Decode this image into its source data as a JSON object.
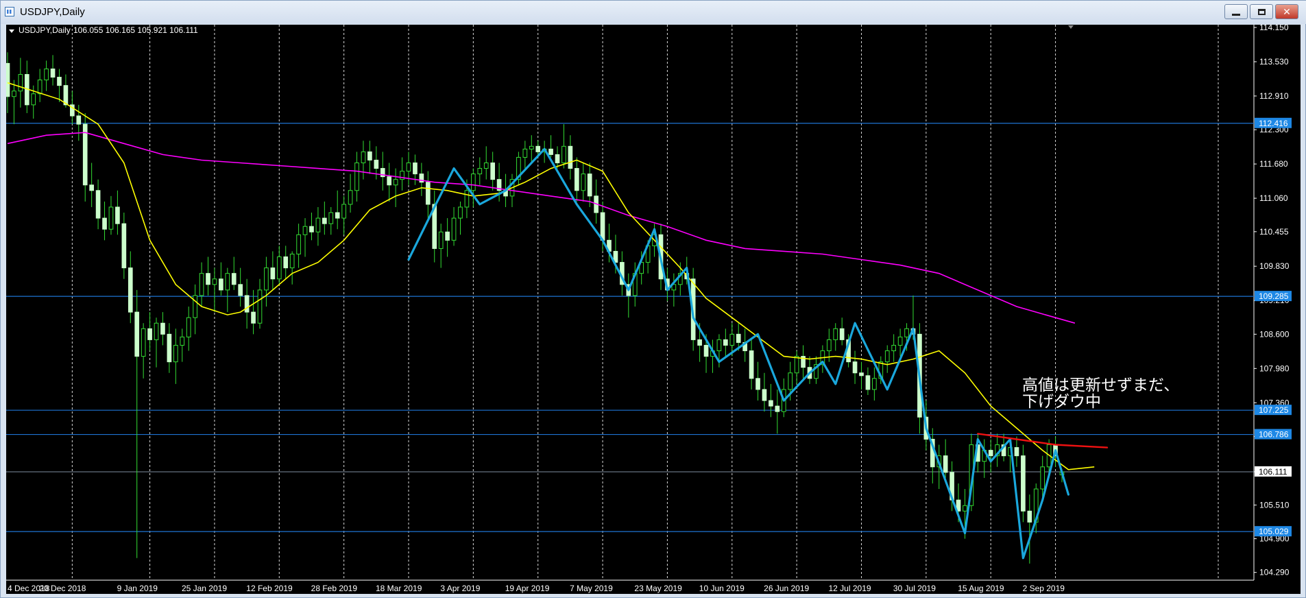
{
  "window": {
    "title": "USDJPY,Daily",
    "buttons": {
      "minimize_icon": "minimize-icon",
      "maximize_icon": "maximize-icon",
      "close_icon": "close-icon"
    }
  },
  "chart_data": {
    "type": "candlestick",
    "header": {
      "symbol_label": "USDJPY,Daily",
      "ohlc_text": "106.055 106.165 105.921 106.111"
    },
    "y_ticks": [
      "114.150",
      "113.530",
      "112.910",
      "112.300",
      "111.680",
      "111.060",
      "110.455",
      "109.830",
      "109.210",
      "108.600",
      "107.980",
      "107.360",
      "106.750",
      "106.111",
      "105.510",
      "104.900",
      "104.290"
    ],
    "x_ticks": [
      "4 Dec 2018",
      "20 Dec 2018",
      "9 Jan 2019",
      "25 Jan 2019",
      "12 Feb 2019",
      "28 Feb 2019",
      "18 Mar 2019",
      "3 Apr 2019",
      "19 Apr 2019",
      "7 May 2019",
      "23 May 2019",
      "10 Jun 2019",
      "26 Jun 2019",
      "12 Jul 2019",
      "30 Jul 2019",
      "15 Aug 2019",
      "2 Sep 2019"
    ],
    "horizontal_levels": [
      {
        "value": 112.416,
        "label": "112.416"
      },
      {
        "value": 109.285,
        "label": "109.285"
      },
      {
        "value": 107.225,
        "label": "107.225"
      },
      {
        "value": 106.786,
        "label": "106.786"
      },
      {
        "value": 105.029,
        "label": "105.029"
      }
    ],
    "current_price": {
      "value": 106.111,
      "label": "106.111"
    },
    "ylim": [
      104.15,
      114.2
    ],
    "colors": {
      "background": "#000000",
      "bull_candle": "#ccffcc",
      "bear_candle": "#ccffcc",
      "wick": "#33dd33",
      "ma_fast": "#ffff00",
      "ma_slow": "#ff00ff",
      "level_line": "#1e73d2",
      "level_label_bg": "#1e88e5",
      "zigzag": "#1aa7dc",
      "trend_line": "#ee1111",
      "grid": "#ffffff"
    },
    "annotation": {
      "line1": "高値は更新せずまだ、",
      "line2": "下げダウ中"
    },
    "candles_ohlc": [
      [
        113.5,
        113.7,
        112.6,
        112.9
      ],
      [
        112.9,
        113.2,
        112.4,
        113.0
      ],
      [
        113.0,
        113.6,
        112.7,
        113.3
      ],
      [
        113.3,
        113.55,
        112.6,
        112.75
      ],
      [
        112.75,
        113.1,
        112.5,
        112.95
      ],
      [
        112.95,
        113.4,
        112.8,
        113.2
      ],
      [
        113.2,
        113.55,
        113.0,
        113.4
      ],
      [
        113.4,
        113.65,
        113.1,
        113.25
      ],
      [
        113.25,
        113.4,
        112.8,
        113.1
      ],
      [
        113.1,
        113.3,
        112.7,
        112.75
      ],
      [
        112.75,
        113.0,
        112.4,
        112.55
      ],
      [
        112.55,
        112.75,
        112.1,
        112.4
      ],
      [
        112.4,
        112.6,
        111.0,
        111.3
      ],
      [
        111.3,
        111.7,
        110.9,
        111.2
      ],
      [
        111.2,
        111.4,
        110.5,
        110.7
      ],
      [
        110.7,
        111.0,
        110.3,
        110.5
      ],
      [
        110.5,
        111.1,
        110.4,
        110.9
      ],
      [
        110.9,
        111.2,
        110.4,
        110.6
      ],
      [
        110.6,
        110.8,
        109.6,
        109.8
      ],
      [
        109.8,
        110.1,
        108.8,
        109.0
      ],
      [
        109.0,
        109.4,
        104.55,
        108.2
      ],
      [
        108.2,
        108.8,
        107.8,
        108.7
      ],
      [
        108.7,
        109.0,
        108.3,
        108.5
      ],
      [
        108.5,
        108.9,
        108.0,
        108.8
      ],
      [
        108.8,
        109.0,
        108.4,
        108.6
      ],
      [
        108.6,
        108.8,
        107.9,
        108.1
      ],
      [
        108.1,
        108.7,
        107.7,
        108.4
      ],
      [
        108.4,
        108.7,
        108.1,
        108.55
      ],
      [
        108.55,
        109.1,
        108.3,
        108.9
      ],
      [
        108.9,
        109.5,
        108.6,
        109.3
      ],
      [
        109.3,
        109.9,
        109.1,
        109.7
      ],
      [
        109.7,
        110.0,
        109.3,
        109.5
      ],
      [
        109.5,
        109.8,
        109.0,
        109.6
      ],
      [
        109.6,
        109.9,
        109.3,
        109.4
      ],
      [
        109.4,
        109.8,
        109.0,
        109.7
      ],
      [
        109.7,
        110.0,
        109.4,
        109.5
      ],
      [
        109.5,
        109.8,
        109.1,
        109.3
      ],
      [
        109.3,
        109.6,
        108.7,
        109.0
      ],
      [
        109.0,
        109.4,
        108.6,
        108.8
      ],
      [
        108.8,
        109.6,
        108.7,
        109.4
      ],
      [
        109.4,
        110.0,
        109.1,
        109.8
      ],
      [
        109.8,
        110.1,
        109.4,
        109.6
      ],
      [
        109.6,
        110.2,
        109.5,
        110.0
      ],
      [
        110.0,
        110.2,
        109.6,
        109.8
      ],
      [
        109.8,
        110.1,
        109.5,
        110.05
      ],
      [
        110.05,
        110.6,
        109.8,
        110.4
      ],
      [
        110.4,
        110.7,
        110.0,
        110.55
      ],
      [
        110.55,
        110.8,
        110.3,
        110.45
      ],
      [
        110.45,
        110.9,
        110.2,
        110.7
      ],
      [
        110.7,
        111.0,
        110.4,
        110.6
      ],
      [
        110.6,
        110.9,
        110.4,
        110.8
      ],
      [
        110.8,
        111.2,
        110.5,
        110.7
      ],
      [
        110.7,
        111.1,
        110.4,
        110.95
      ],
      [
        110.95,
        111.5,
        110.8,
        111.2
      ],
      [
        111.2,
        111.9,
        111.0,
        111.7
      ],
      [
        111.7,
        112.1,
        111.4,
        111.9
      ],
      [
        111.9,
        112.1,
        111.5,
        111.75
      ],
      [
        111.75,
        112.0,
        111.4,
        111.6
      ],
      [
        111.6,
        111.9,
        111.2,
        111.45
      ],
      [
        111.45,
        111.7,
        111.0,
        111.3
      ],
      [
        111.3,
        111.6,
        110.9,
        111.4
      ],
      [
        111.4,
        111.8,
        111.2,
        111.55
      ],
      [
        111.55,
        111.9,
        111.3,
        111.7
      ],
      [
        111.7,
        111.85,
        111.3,
        111.5
      ],
      [
        111.5,
        111.7,
        111.1,
        111.35
      ],
      [
        111.35,
        111.55,
        110.7,
        110.95
      ],
      [
        110.95,
        111.2,
        109.9,
        110.15
      ],
      [
        110.15,
        110.6,
        109.8,
        110.45
      ],
      [
        110.45,
        110.7,
        110.0,
        110.3
      ],
      [
        110.3,
        110.9,
        110.2,
        110.7
      ],
      [
        110.7,
        111.0,
        110.4,
        110.9
      ],
      [
        110.9,
        111.4,
        110.7,
        111.2
      ],
      [
        111.2,
        111.6,
        110.9,
        111.5
      ],
      [
        111.5,
        111.8,
        111.3,
        111.6
      ],
      [
        111.6,
        112.0,
        111.4,
        111.7
      ],
      [
        111.7,
        111.9,
        111.2,
        111.4
      ],
      [
        111.4,
        111.7,
        111.0,
        111.2
      ],
      [
        111.2,
        111.5,
        110.9,
        111.1
      ],
      [
        111.1,
        111.5,
        110.9,
        111.4
      ],
      [
        111.4,
        111.9,
        111.3,
        111.8
      ],
      [
        111.8,
        112.1,
        111.6,
        111.95
      ],
      [
        111.95,
        112.2,
        111.7,
        112.0
      ],
      [
        112.0,
        112.1,
        111.8,
        111.9
      ],
      [
        111.9,
        112.1,
        111.7,
        111.95
      ],
      [
        111.95,
        112.2,
        111.8,
        111.85
      ],
      [
        111.85,
        112.0,
        111.6,
        111.7
      ],
      [
        111.7,
        112.4,
        111.6,
        112.0
      ],
      [
        112.0,
        112.2,
        111.4,
        111.6
      ],
      [
        111.6,
        111.8,
        111.0,
        111.2
      ],
      [
        111.2,
        111.7,
        111.0,
        111.5
      ],
      [
        111.5,
        111.7,
        110.9,
        111.1
      ],
      [
        111.1,
        111.4,
        110.6,
        110.8
      ],
      [
        110.8,
        111.0,
        110.1,
        110.3
      ],
      [
        110.3,
        110.6,
        109.9,
        110.1
      ],
      [
        110.1,
        110.4,
        109.7,
        109.9
      ],
      [
        109.9,
        110.1,
        109.3,
        109.5
      ],
      [
        109.5,
        109.7,
        108.9,
        109.3
      ],
      [
        109.3,
        109.9,
        109.1,
        109.7
      ],
      [
        109.7,
        110.1,
        109.5,
        109.9
      ],
      [
        109.9,
        110.3,
        109.7,
        110.2
      ],
      [
        110.2,
        110.6,
        110.0,
        110.4
      ],
      [
        110.4,
        110.6,
        109.4,
        109.6
      ],
      [
        109.6,
        109.8,
        109.2,
        109.4
      ],
      [
        109.4,
        109.7,
        109.1,
        109.5
      ],
      [
        109.5,
        109.9,
        109.3,
        109.7
      ],
      [
        109.7,
        110.0,
        109.5,
        109.6
      ],
      [
        109.6,
        109.8,
        108.3,
        108.5
      ],
      [
        108.5,
        108.8,
        108.1,
        108.4
      ],
      [
        108.4,
        108.6,
        107.9,
        108.2
      ],
      [
        108.2,
        108.5,
        107.9,
        108.3
      ],
      [
        108.3,
        108.6,
        108.0,
        108.5
      ],
      [
        108.5,
        108.7,
        108.2,
        108.4
      ],
      [
        108.4,
        108.8,
        108.2,
        108.6
      ],
      [
        108.6,
        108.8,
        108.3,
        108.45
      ],
      [
        108.45,
        108.7,
        108.1,
        108.3
      ],
      [
        108.3,
        108.5,
        107.6,
        107.8
      ],
      [
        107.8,
        108.1,
        107.4,
        107.6
      ],
      [
        107.6,
        107.9,
        107.2,
        107.4
      ],
      [
        107.4,
        107.7,
        107.1,
        107.3
      ],
      [
        107.3,
        107.6,
        106.8,
        107.2
      ],
      [
        107.2,
        107.8,
        107.1,
        107.6
      ],
      [
        107.6,
        108.1,
        107.4,
        107.9
      ],
      [
        107.9,
        108.3,
        107.7,
        108.2
      ],
      [
        108.2,
        108.4,
        107.8,
        108.0
      ],
      [
        108.0,
        108.2,
        107.7,
        107.8
      ],
      [
        107.8,
        108.2,
        107.7,
        108.05
      ],
      [
        108.05,
        108.4,
        107.9,
        108.3
      ],
      [
        108.3,
        108.7,
        108.1,
        108.5
      ],
      [
        108.5,
        108.8,
        108.3,
        108.7
      ],
      [
        108.7,
        108.9,
        108.4,
        108.5
      ],
      [
        108.5,
        108.6,
        108.0,
        108.1
      ],
      [
        108.1,
        108.3,
        107.7,
        107.9
      ],
      [
        107.9,
        108.1,
        107.6,
        107.85
      ],
      [
        107.85,
        108.0,
        107.5,
        107.6
      ],
      [
        107.6,
        108.0,
        107.4,
        107.8
      ],
      [
        107.8,
        108.2,
        107.7,
        108.1
      ],
      [
        108.1,
        108.4,
        107.9,
        108.3
      ],
      [
        108.3,
        108.6,
        108.1,
        108.4
      ],
      [
        108.4,
        108.7,
        108.2,
        108.55
      ],
      [
        108.55,
        108.8,
        108.3,
        108.7
      ],
      [
        108.7,
        109.3,
        108.5,
        108.6
      ],
      [
        108.6,
        108.8,
        106.8,
        107.1
      ],
      [
        107.1,
        107.4,
        106.5,
        106.7
      ],
      [
        106.7,
        106.9,
        105.9,
        106.2
      ],
      [
        106.2,
        106.6,
        105.8,
        106.4
      ],
      [
        106.4,
        106.7,
        106.0,
        106.1
      ],
      [
        106.1,
        106.3,
        105.4,
        105.6
      ],
      [
        105.6,
        105.9,
        105.2,
        105.4
      ],
      [
        105.4,
        105.8,
        104.9,
        105.5
      ],
      [
        105.5,
        106.8,
        105.4,
        106.6
      ],
      [
        106.6,
        106.8,
        106.1,
        106.3
      ],
      [
        106.3,
        106.7,
        106.0,
        106.5
      ],
      [
        106.5,
        106.7,
        106.1,
        106.4
      ],
      [
        106.4,
        106.8,
        106.2,
        106.6
      ],
      [
        106.6,
        106.8,
        106.3,
        106.4
      ],
      [
        106.4,
        106.7,
        106.1,
        106.55
      ],
      [
        106.55,
        106.75,
        106.2,
        106.4
      ],
      [
        106.4,
        106.6,
        105.2,
        105.4
      ],
      [
        105.4,
        105.7,
        104.45,
        105.2
      ],
      [
        105.2,
        105.9,
        105.0,
        105.8
      ],
      [
        105.8,
        106.4,
        105.6,
        106.2
      ],
      [
        106.2,
        106.7,
        106.0,
        106.6
      ],
      [
        106.6,
        106.75,
        106.2,
        106.4
      ],
      [
        106.055,
        106.165,
        105.921,
        106.111
      ]
    ],
    "ma_fast_points": [
      [
        0,
        113.15
      ],
      [
        8,
        112.85
      ],
      [
        14,
        112.4
      ],
      [
        18,
        111.7
      ],
      [
        22,
        110.3
      ],
      [
        26,
        109.5
      ],
      [
        30,
        109.1
      ],
      [
        34,
        108.95
      ],
      [
        36,
        109.0
      ],
      [
        40,
        109.3
      ],
      [
        44,
        109.7
      ],
      [
        48,
        109.9
      ],
      [
        52,
        110.3
      ],
      [
        56,
        110.85
      ],
      [
        60,
        111.1
      ],
      [
        64,
        111.25
      ],
      [
        68,
        111.2
      ],
      [
        72,
        111.1
      ],
      [
        76,
        111.15
      ],
      [
        80,
        111.35
      ],
      [
        84,
        111.6
      ],
      [
        88,
        111.75
      ],
      [
        92,
        111.55
      ],
      [
        96,
        110.8
      ],
      [
        100,
        110.3
      ],
      [
        104,
        109.8
      ],
      [
        108,
        109.25
      ],
      [
        112,
        108.9
      ],
      [
        116,
        108.55
      ],
      [
        120,
        108.2
      ],
      [
        124,
        108.15
      ],
      [
        128,
        108.2
      ],
      [
        132,
        108.15
      ],
      [
        136,
        108.05
      ],
      [
        140,
        108.15
      ],
      [
        144,
        108.3
      ],
      [
        148,
        107.9
      ],
      [
        152,
        107.3
      ],
      [
        156,
        106.9
      ],
      [
        160,
        106.5
      ],
      [
        164,
        106.15
      ],
      [
        168,
        106.2
      ]
    ],
    "ma_slow_points": [
      [
        0,
        112.05
      ],
      [
        6,
        112.2
      ],
      [
        12,
        112.25
      ],
      [
        18,
        112.05
      ],
      [
        24,
        111.85
      ],
      [
        30,
        111.75
      ],
      [
        36,
        111.7
      ],
      [
        42,
        111.65
      ],
      [
        48,
        111.6
      ],
      [
        54,
        111.55
      ],
      [
        60,
        111.45
      ],
      [
        66,
        111.35
      ],
      [
        72,
        111.3
      ],
      [
        78,
        111.2
      ],
      [
        84,
        111.1
      ],
      [
        90,
        111.0
      ],
      [
        96,
        110.75
      ],
      [
        102,
        110.55
      ],
      [
        108,
        110.3
      ],
      [
        114,
        110.15
      ],
      [
        120,
        110.1
      ],
      [
        126,
        110.05
      ],
      [
        132,
        109.95
      ],
      [
        138,
        109.85
      ],
      [
        144,
        109.7
      ],
      [
        150,
        109.4
      ],
      [
        156,
        109.1
      ],
      [
        162,
        108.9
      ],
      [
        165,
        108.8
      ]
    ],
    "zigzag_points": [
      [
        62,
        109.95
      ],
      [
        66,
        110.9
      ],
      [
        69,
        111.6
      ],
      [
        73,
        110.95
      ],
      [
        77,
        111.2
      ],
      [
        83,
        111.95
      ],
      [
        88,
        110.95
      ],
      [
        92,
        110.3
      ],
      [
        96,
        109.4
      ],
      [
        100,
        110.5
      ],
      [
        102,
        109.4
      ],
      [
        105,
        109.8
      ],
      [
        106,
        108.9
      ],
      [
        110,
        108.1
      ],
      [
        116,
        108.6
      ],
      [
        120,
        107.4
      ],
      [
        124,
        107.9
      ],
      [
        126,
        108.1
      ],
      [
        128,
        107.7
      ],
      [
        131,
        108.8
      ],
      [
        136,
        107.6
      ],
      [
        140,
        108.7
      ],
      [
        142,
        106.9
      ],
      [
        148,
        105.0
      ],
      [
        150,
        106.7
      ],
      [
        152,
        106.3
      ],
      [
        155,
        106.7
      ],
      [
        157,
        104.55
      ],
      [
        160,
        105.6
      ],
      [
        162,
        106.5
      ],
      [
        164,
        105.7
      ]
    ],
    "trend_points": [
      [
        150,
        106.8
      ],
      [
        156,
        106.7
      ],
      [
        162,
        106.6
      ],
      [
        170,
        106.55
      ]
    ]
  }
}
